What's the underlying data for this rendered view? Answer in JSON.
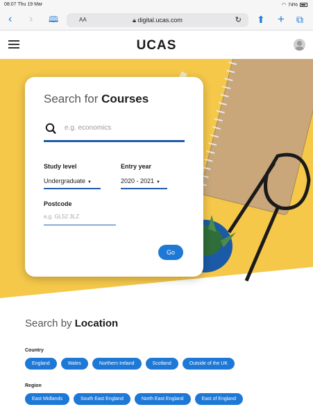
{
  "status_bar": {
    "time_date": "08:07  Thu 19 Mar",
    "battery": "74%"
  },
  "browser": {
    "text_size": "AA",
    "url": "digital.ucas.com"
  },
  "header": {
    "logo": "UCAS"
  },
  "search": {
    "title_prefix": "Search for ",
    "title_bold": "Courses",
    "placeholder": "e.g. economics",
    "study_level_label": "Study level",
    "study_level_value": "Undergraduate",
    "entry_year_label": "Entry year",
    "entry_year_value": "2020 - 2021",
    "postcode_label": "Postcode",
    "postcode_placeholder": "e.g. GL52 3LZ",
    "go_label": "Go"
  },
  "location": {
    "title_prefix": "Search by ",
    "title_bold": "Location",
    "country_label": "Country",
    "countries": [
      "England",
      "Wales",
      "Northern Ireland",
      "Scotland",
      "Outside of the UK"
    ],
    "region_label": "Region",
    "regions": [
      "East Midlands",
      "South East England",
      "North East England",
      "East of England"
    ]
  },
  "colors": {
    "accent": "#1e78d6",
    "hero_yellow": "#f5c84a",
    "underline": "#1e5aa8"
  }
}
